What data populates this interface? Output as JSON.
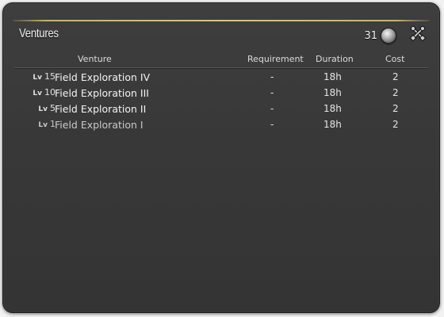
{
  "window": {
    "title": "Ventures",
    "currency_count": "31",
    "currency_icon": "venture-coin-icon",
    "settings_icon": "crossed-tools-icon"
  },
  "columns": {
    "venture": "Venture",
    "requirement": "Requirement",
    "duration": "Duration",
    "cost": "Cost"
  },
  "ventures": [
    {
      "lv_prefix": "Lv",
      "level": "15",
      "name": "Field Exploration IV",
      "requirement": "-",
      "duration": "18h",
      "cost": "2"
    },
    {
      "lv_prefix": "Lv",
      "level": "10",
      "name": "Field Exploration III",
      "requirement": "-",
      "duration": "18h",
      "cost": "2"
    },
    {
      "lv_prefix": "Lv",
      "level": "5",
      "name": "Field Exploration II",
      "requirement": "-",
      "duration": "18h",
      "cost": "2"
    },
    {
      "lv_prefix": "Lv",
      "level": "1",
      "name": "Field Exploration I",
      "requirement": "-",
      "duration": "18h",
      "cost": "2"
    }
  ],
  "colors": {
    "accent_gold": "#d8c18c",
    "panel": "#3a3a3a"
  }
}
